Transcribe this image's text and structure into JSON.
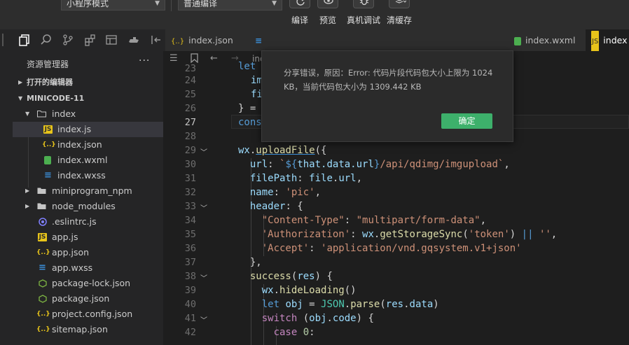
{
  "toolbar": {
    "mode_select": "小程序模式",
    "compile_select": "普通编译",
    "buttons": {
      "compile": "编译",
      "preview": "预览",
      "real_device_debug": "真机调试",
      "clear_cache": "清缓存"
    }
  },
  "tabs": [
    {
      "label": "index.json",
      "icon": "json-icon"
    },
    {
      "label": "index.wxml",
      "icon": "wxml-icon"
    },
    {
      "label": "index",
      "icon": "js-icon"
    }
  ],
  "explorer": {
    "title": "资源管理器",
    "open_editors": "打开的编辑器",
    "project": "MINICODE-11",
    "items": [
      {
        "label": "index",
        "type": "folder"
      },
      {
        "label": "index.js",
        "type": "js"
      },
      {
        "label": "index.json",
        "type": "json"
      },
      {
        "label": "index.wxml",
        "type": "wxml"
      },
      {
        "label": "index.wxss",
        "type": "wxss"
      },
      {
        "label": "miniprogram_npm",
        "type": "folder"
      },
      {
        "label": "node_modules",
        "type": "folder"
      },
      {
        "label": ".eslintrc.js",
        "type": "eslint"
      },
      {
        "label": "app.js",
        "type": "js"
      },
      {
        "label": "app.json",
        "type": "json"
      },
      {
        "label": "app.wxss",
        "type": "wxss"
      },
      {
        "label": "package-lock.json",
        "type": "pkg"
      },
      {
        "label": "package.json",
        "type": "pkg"
      },
      {
        "label": "project.config.json",
        "type": "json"
      },
      {
        "label": "sitemap.json",
        "type": "json"
      }
    ]
  },
  "breadcrumb_text": "ind",
  "line_numbers": [
    "23",
    "24",
    "25",
    "26",
    "27",
    "28",
    "29",
    "30",
    "31",
    "32",
    "33",
    "34",
    "35",
    "36",
    "37",
    "38",
    "39",
    "40",
    "41",
    "42"
  ],
  "current_line": "27",
  "code_lines": {
    "l23": "let",
    "l24": "im",
    "l25": "fi",
    "l26": "} =",
    "l27": "cons",
    "l29": "wx.uploadFile({",
    "l30": "  url: `${that.data.url}/api/qdimg/imgupload`,",
    "l31": "  filePath: file.url,",
    "l32": "  name: 'pic',",
    "l33": "  header: {",
    "l34": "    \"Content-Type\": \"multipart/form-data\",",
    "l35": "    'Authorization': wx.getStorageSync('token') || '',",
    "l36": "    'Accept': 'application/vnd.gqsystem.v1+json'",
    "l37": "  },",
    "l38": "  success(res) {",
    "l39": "    wx.hideLoading()",
    "l40": "    let obj = JSON.parse(res.data)",
    "l41": "    switch (obj.code) {",
    "l42": "      case 0:"
  },
  "dialog": {
    "message": "分享错误，原因：Error: 代码片段代码包大小上限为 1024 KB，当前代码包大小为 1309.442 KB",
    "ok_label": "确定"
  },
  "colors": {
    "ok_button": "#3db06b",
    "js_icon": "#e8c41a",
    "wxss_icon": "#3b8fd9",
    "wxml_icon": "#4caf50"
  }
}
